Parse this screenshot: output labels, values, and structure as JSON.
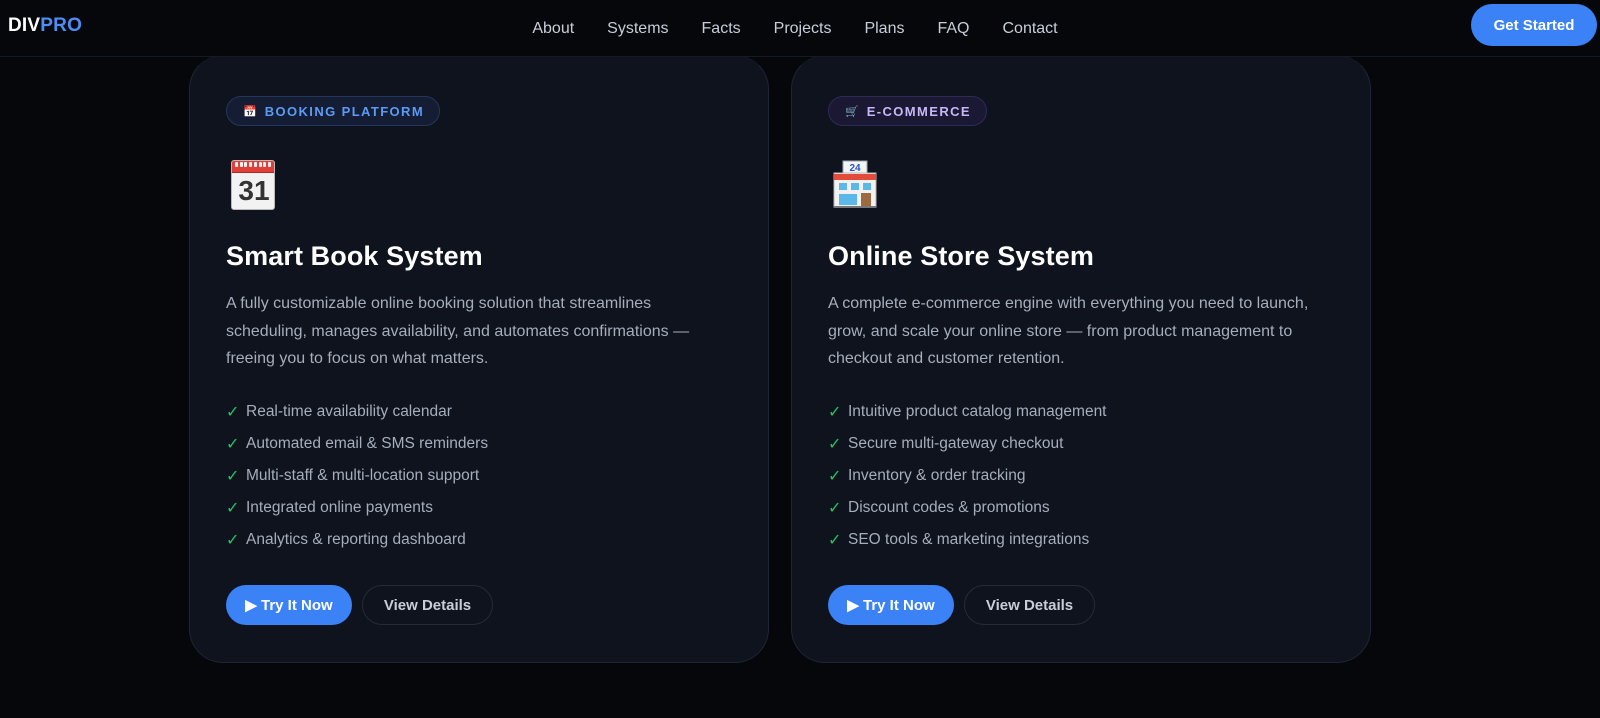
{
  "nav": {
    "logo_a": "DIV",
    "logo_b": "PRO",
    "links": [
      "About",
      "Systems",
      "Facts",
      "Projects",
      "Plans",
      "FAQ",
      "Contact"
    ],
    "cta": "Get Started"
  },
  "cards": [
    {
      "badge_icon": "📅",
      "badge": "BOOKING PLATFORM",
      "icon": "calendar-icon",
      "icon_number": "31",
      "title": "Smart Book System",
      "description": "A fully customizable online booking solution that streamlines scheduling, manages availability, and automates confirmations — freeing you to focus on what matters.",
      "features": [
        "Real-time availability calendar",
        "Automated email & SMS reminders",
        "Multi-staff & multi-location support",
        "Integrated online payments",
        "Analytics & reporting dashboard"
      ],
      "primary": "▶ Try It Now",
      "secondary": "View Details"
    },
    {
      "badge_icon": "🛒",
      "badge": "E-COMMERCE",
      "icon": "store-icon",
      "icon_number": "24",
      "title": "Online Store System",
      "description": "A complete e-commerce engine with everything you need to launch, grow, and scale your online store — from product management to checkout and customer retention.",
      "features": [
        "Intuitive product catalog management",
        "Secure multi-gateway checkout",
        "Inventory & order tracking",
        "Discount codes & promotions",
        "SEO tools & marketing integrations"
      ],
      "primary": "▶ Try It Now",
      "secondary": "View Details"
    }
  ],
  "colors": {
    "accent": "#3b82f6",
    "check": "#22c55e",
    "background": "#06070b",
    "card": "#0f131e"
  }
}
